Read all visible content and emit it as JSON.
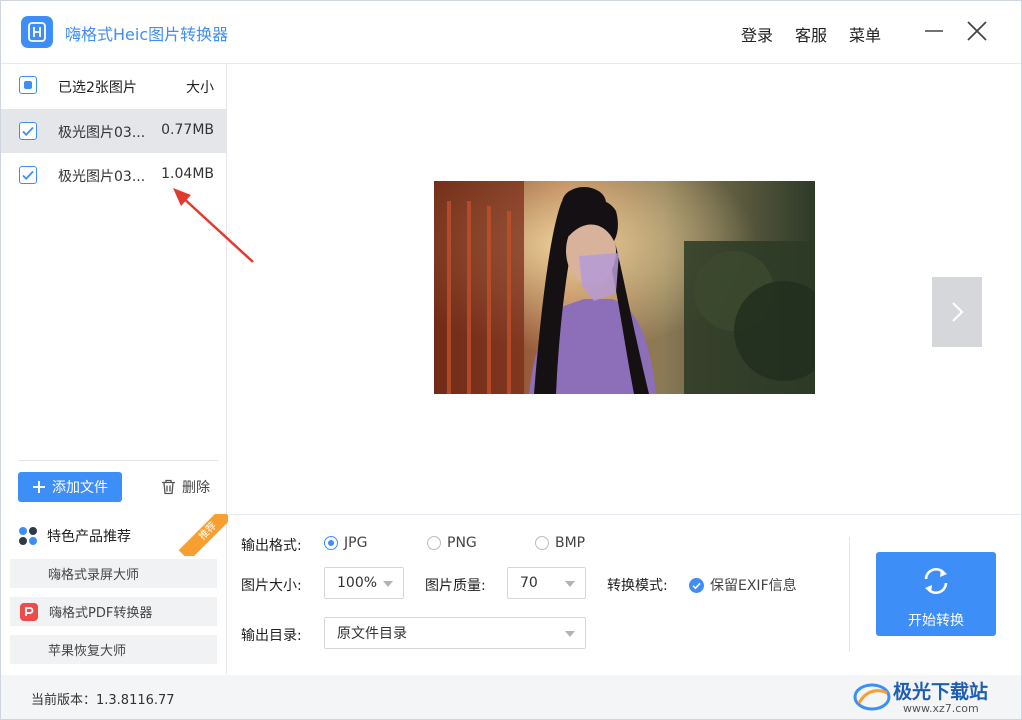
{
  "app": {
    "title": "嗨格式Heic图片转换器"
  },
  "header": {
    "login": "登录",
    "service": "客服",
    "menu": "菜单"
  },
  "file_list": {
    "header_label": "已选2张图片",
    "size_header": "大小",
    "files": [
      {
        "name": "极光图片03...",
        "size": "0.77MB",
        "checked": true,
        "selected": true
      },
      {
        "name": "极光图片03...",
        "size": "1.04MB",
        "checked": true,
        "selected": false
      }
    ],
    "add_button": "添加文件",
    "delete_button": "删除"
  },
  "products": {
    "title": "特色产品推荐",
    "badge": "推荐",
    "items": [
      "嗨格式录屏大师",
      "嗨格式PDF转换器",
      "苹果恢复大师"
    ]
  },
  "settings": {
    "format_label": "输出格式:",
    "formats": [
      "JPG",
      "PNG",
      "BMP"
    ],
    "selected_format": "JPG",
    "size_label": "图片大小:",
    "size_value": "100%",
    "quality_label": "图片质量:",
    "quality_value": "70",
    "mode_label": "转换模式:",
    "exif_label": "保留EXIF信息",
    "exif_checked": true,
    "output_dir_label": "输出目录:",
    "output_dir_value": "原文件目录"
  },
  "start_button": "开始转换",
  "status": {
    "version": "当前版本：1.3.8116.77"
  },
  "watermark": {
    "name": "极光下载站",
    "url": "www.xz7.com"
  },
  "colors": {
    "accent": "#3e8ef7",
    "badge": "#f7a031",
    "annotation_arrow": "#e23a2e"
  }
}
